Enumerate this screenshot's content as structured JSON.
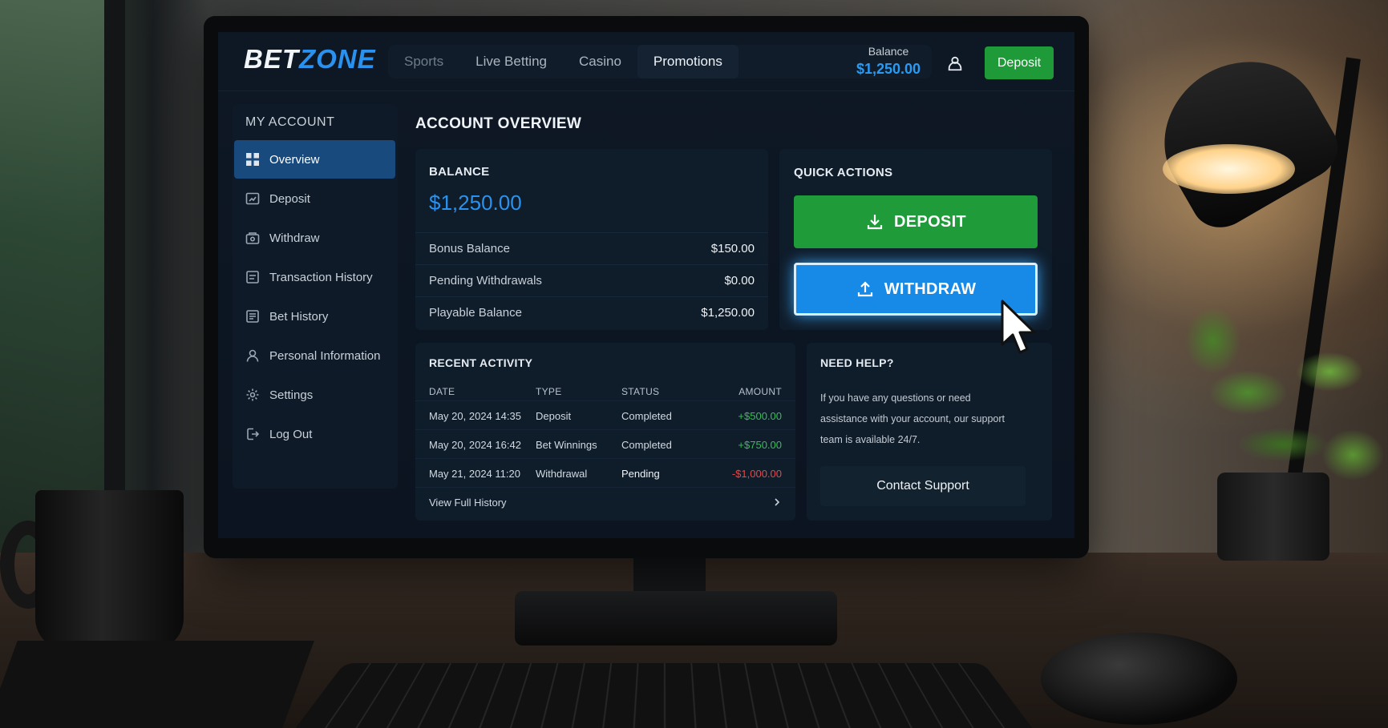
{
  "brand": {
    "part1": "BET",
    "part2": "ZONE"
  },
  "nav": [
    {
      "label": "Sports"
    },
    {
      "label": "Live Betting"
    },
    {
      "label": "Casino"
    },
    {
      "label": "Promotions"
    }
  ],
  "header": {
    "balance_label": "Balance",
    "balance_value": "$1,250.00",
    "user_icon": "user-icon",
    "deposit_label": "Deposit",
    "accent_color": "#2a92ee",
    "deposit_color": "#1e9a38"
  },
  "sidebar": {
    "title": "MY ACCOUNT",
    "items": [
      {
        "label": "Overview",
        "icon": "grid-icon",
        "active": true
      },
      {
        "label": "Deposit",
        "icon": "wallet-icon"
      },
      {
        "label": "Withdraw",
        "icon": "cash-icon"
      },
      {
        "label": "Transaction History",
        "icon": "list-icon"
      },
      {
        "label": "Bet History",
        "icon": "receipt-icon"
      },
      {
        "label": "Personal Information",
        "icon": "person-icon"
      },
      {
        "label": "Settings",
        "icon": "gear-icon"
      },
      {
        "label": "Log Out",
        "icon": "logout-icon"
      }
    ]
  },
  "main": {
    "title": "ACCOUNT OVERVIEW",
    "balance": {
      "title": "BALANCE",
      "amount": "$1,250.00",
      "rows": [
        {
          "label": "Bonus Balance",
          "value": "$150.00"
        },
        {
          "label": "Pending Withdrawals",
          "value": "$0.00"
        },
        {
          "label": "Playable Balance",
          "value": "$1,250.00"
        }
      ]
    },
    "quick_actions": {
      "title": "QUICK ACTIONS",
      "deposit_label": "DEPOSIT",
      "withdraw_label": "WITHDRAW"
    },
    "recent_activity": {
      "title": "RECENT ACTIVITY",
      "columns": [
        "DATE",
        "TYPE",
        "STATUS",
        "AMOUNT"
      ],
      "rows": [
        {
          "date": "May 20, 2024 14:35",
          "type": "Deposit",
          "status": "Completed",
          "amount": "+$500.00",
          "sign": "pos"
        },
        {
          "date": "May 20, 2024 16:42",
          "type": "Bet Winnings",
          "status": "Completed",
          "amount": "+$750.00",
          "sign": "pos"
        },
        {
          "date": "May 21, 2024 11:20",
          "type": "Withdrawal",
          "status": "Pending",
          "amount": "-$1,000.00",
          "sign": "neg"
        }
      ],
      "footer_link": "View Full History"
    },
    "help": {
      "title": "NEED HELP?",
      "text": "If you have any questions or need assistance with your account, our support team is available 24/7.",
      "button": "Contact Support"
    }
  }
}
